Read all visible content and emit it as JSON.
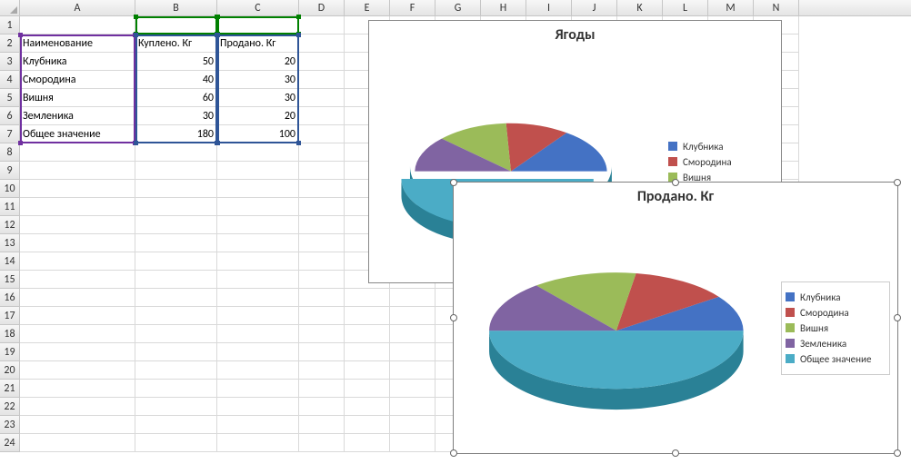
{
  "columns": [
    "A",
    "B",
    "C",
    "D",
    "E",
    "F",
    "G",
    "H",
    "I",
    "J",
    "K",
    "L",
    "M",
    "N"
  ],
  "rowCount": 24,
  "table": {
    "headers": {
      "A": "Наименование",
      "B": "Куплено. Кг",
      "C": "Продано. Кг"
    },
    "rows": [
      {
        "A": "Клубника",
        "B": "50",
        "C": "20"
      },
      {
        "A": "Смородина",
        "B": "40",
        "C": "30"
      },
      {
        "A": "Вишня",
        "B": "60",
        "C": "30"
      },
      {
        "A": "Земленика",
        "B": "30",
        "C": "20"
      },
      {
        "A": "Общее значение",
        "B": "180",
        "C": "100"
      }
    ]
  },
  "chart1": {
    "title": "Ягоды",
    "legend": [
      "Клубника",
      "Смородина",
      "Вишня"
    ]
  },
  "chart2": {
    "title": "Продано. Кг",
    "legend": [
      "Клубника",
      "Смородина",
      "Вишня",
      "Земленика",
      "Общее значение"
    ]
  },
  "colors": {
    "series": [
      "#4472c4",
      "#c0504d",
      "#9bbb59",
      "#8064a2",
      "#4bacc6"
    ]
  },
  "chart_data": [
    {
      "type": "pie",
      "title": "Ягоды",
      "categories": [
        "Клубника",
        "Смородина",
        "Вишня",
        "Земленика",
        "Общее значение"
      ],
      "values": [
        50,
        40,
        60,
        30,
        180
      ]
    },
    {
      "type": "pie",
      "title": "Продано. Кг",
      "categories": [
        "Клубника",
        "Смородина",
        "Вишня",
        "Земленика",
        "Общее значение"
      ],
      "values": [
        20,
        30,
        30,
        20,
        100
      ]
    }
  ]
}
